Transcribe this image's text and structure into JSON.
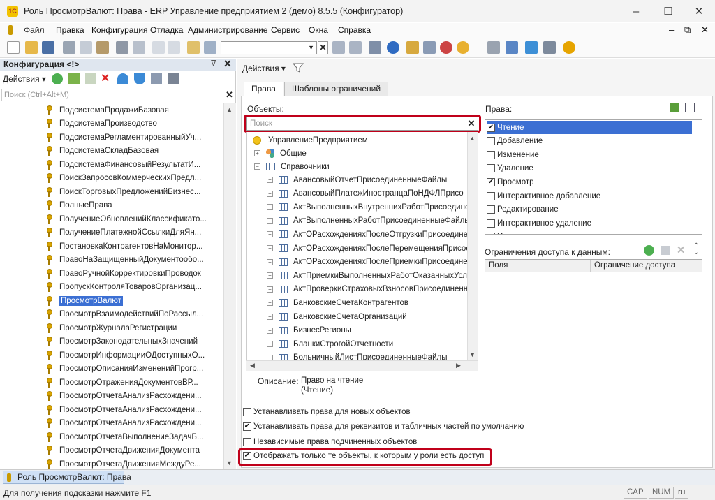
{
  "window": {
    "title": "Роль ПросмотрВалют: Права - ERP Управление предприятием 2 (демо) 8.5.5 (Конфигуратор)",
    "app_icon_text": "1С",
    "minimize": "–",
    "maximize": "☐",
    "close": "✕"
  },
  "menubar": {
    "items": [
      "Файл",
      "Правка",
      "Конфигурация",
      "Отладка",
      "Администрирование",
      "Сервис",
      "Окна",
      "Справка"
    ],
    "right_controls": [
      "–",
      "⧉",
      "✕"
    ]
  },
  "toolbar": {
    "search_value": ""
  },
  "left_panel": {
    "title": "Конфигурация <!>",
    "actions_label": "Действия",
    "search_placeholder": "Поиск (Ctrl+Alt+M)",
    "items": [
      "ПодсистемаПродажиБазовая",
      "ПодсистемаПроизводство",
      "ПодсистемаРегламентированныйУч...",
      "ПодсистемаСкладБазовая",
      "ПодсистемаФинансовыйРезультатИ...",
      "ПоискЗапросовКоммерческихПредл...",
      "ПоискТорговыхПредложенийБизнес...",
      "ПолныеПрава",
      "ПолучениеОбновленийКлассификато...",
      "ПолучениеПлатежнойСсылкиДляЯн...",
      "ПостановкаКонтрагентовНаМонитор...",
      "ПравоНаЗащищенныйДокументообо...",
      "ПравоРучнойКорректировкиПроводок",
      "ПропускКонтроляТоваровОрганизац...",
      "ПросмотрВалют",
      "ПросмотрВзаимодействийПоРассыл...",
      "ПросмотрЖурналаРегистрации",
      "ПросмотрЗаконодательныхЗначений",
      "ПросмотрИнформацииОДоступныхО...",
      "ПросмотрОписанияИзмененийПрогр...",
      "ПросмотрОтраженияДокументовВР...",
      "ПросмотрОтчетаАнализРасхождени...",
      "ПросмотрОтчетаАнализРасхождени...",
      "ПросмотрОтчетаАнализРасхождени...",
      "ПросмотрОтчетаВыполнениеЗадачБ...",
      "ПросмотрОтчетаДвиженияДокумента",
      "ПросмотрОтчетаДвиженияМеждуРе..."
    ],
    "selected_index": 14
  },
  "right_panel": {
    "actions_label": "Действия",
    "tabs": [
      "Права",
      "Шаблоны ограничений"
    ],
    "objects_label": "Объекты:",
    "objects_search_placeholder": "Поиск",
    "tree": {
      "root": "УправлениеПредприятием",
      "common": "Общие",
      "catalogs": "Справочники",
      "items": [
        "АвансовыйОтчетПрисоединенныеФайлы",
        "АвансовыйПлатежИностранцаПоНДФЛПрисо",
        "АктВыполненныхВнутреннихРаботПрисоедине",
        "АктВыполненныхРаботПрисоединенныеФайль",
        "АктОРасхожденияхПослеОтгрузкиПрисоедине",
        "АктОРасхожденияхПослеПеремещенияПрисое",
        "АктОРасхожденияхПослеПриемкиПрисоедине",
        "АктПриемкиВыполненныхРаботОказанныхУсл",
        "АктПроверкиСтраховыхВзносовПрисоединенн",
        "БанковскиеСчетаКонтрагентов",
        "БанковскиеСчетаОрганизаций",
        "БизнесРегионы",
        "БланкиСтрогойОтчетности",
        "БольничныйЛистПрисоединенныеФайлы"
      ]
    },
    "description_label": "Описание:",
    "description_value_1": "Право на чтение",
    "description_value_2": "(Чтение)",
    "rights_label": "Права:",
    "rights": [
      {
        "label": "Чтение",
        "checked": true
      },
      {
        "label": "Добавление",
        "checked": false
      },
      {
        "label": "Изменение",
        "checked": false
      },
      {
        "label": "Удаление",
        "checked": false
      },
      {
        "label": "Просмотр",
        "checked": true
      },
      {
        "label": "Интерактивное добавление",
        "checked": false
      },
      {
        "label": "Редактирование",
        "checked": false
      },
      {
        "label": "Интерактивное удаление",
        "checked": false
      },
      {
        "label": "Интерактивная пометка на удаление",
        "checked": false
      }
    ],
    "restrictions_label": "Ограничения доступа к данным:",
    "restrictions_columns": [
      "Поля",
      "Ограничение доступа"
    ],
    "options": [
      {
        "label": "Устанавливать права для новых объектов",
        "checked": false
      },
      {
        "label": "Устанавливать права для реквизитов и табличных частей по умолчанию",
        "checked": true
      },
      {
        "label": "Независимые права подчиненных объектов",
        "checked": false
      },
      {
        "label": "Отображать только те объекты, к которым у роли есть доступ",
        "checked": true
      }
    ]
  },
  "taskbar": {
    "active_window": "Роль ПросмотрВалют: Права"
  },
  "statusbar": {
    "hint": "Для получения подсказки нажмите F1",
    "cap": "CAP",
    "num": "NUM",
    "lang": "ru"
  },
  "colors": {
    "selection": "#3b6fd3",
    "highlight_frame": "#c0001a"
  }
}
